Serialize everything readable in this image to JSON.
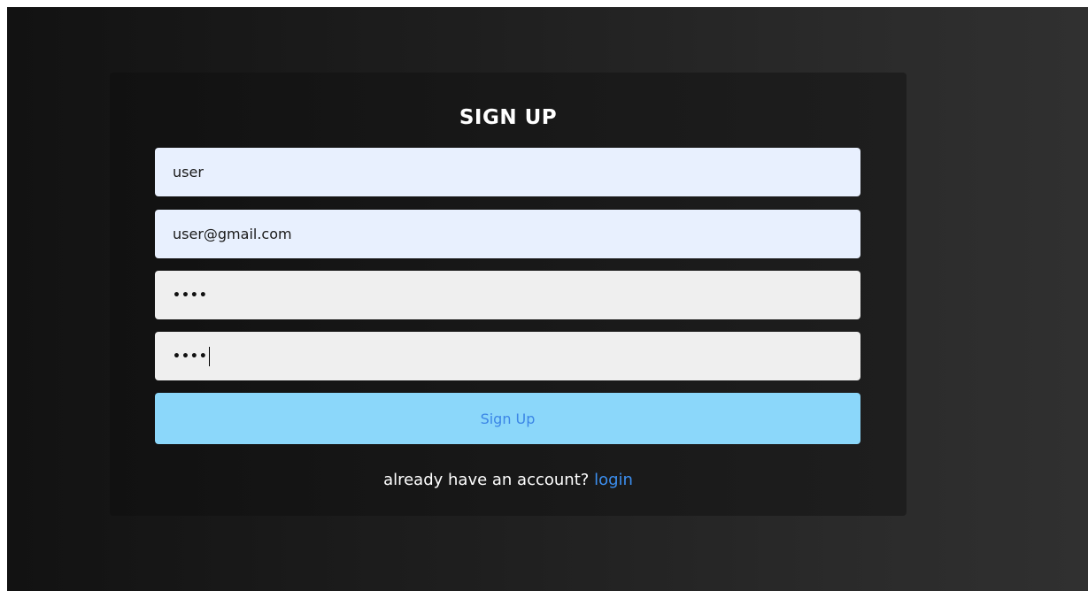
{
  "form": {
    "title": "SIGN UP",
    "username_value": "user",
    "email_value": "user@gmail.com",
    "password_value": "••••",
    "confirm_password_value": "••••",
    "submit_label": "Sign Up"
  },
  "footer": {
    "prompt": "already have an account?",
    "login_link": "login"
  },
  "colors": {
    "background_dark": "#121212",
    "background_light": "#303030",
    "card": "#181818",
    "autofill_input": "#e8f0fe",
    "plain_input": "#efefef",
    "button": "#8bd7fa",
    "button_text": "#3b86e6",
    "link": "#3c8ff0"
  }
}
